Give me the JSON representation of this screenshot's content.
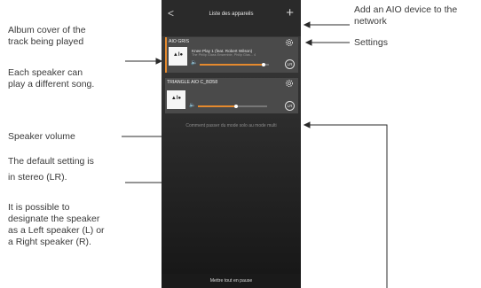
{
  "app": {
    "title": "Liste des appareils",
    "back_glyph": "<",
    "add_glyph": "+",
    "help_text": "Comment passer du mode solo au mode multi",
    "pause_all_label": "Mettre tout en pause"
  },
  "devices": [
    {
      "name": "AIO GRIS",
      "cover_logo": "▲I●",
      "track": "Knee Play 1 (feat. Robert Wilson)",
      "artist_line": "The Philip Glass Ensemble, Philip Glas... 4",
      "volume": 0.92,
      "channel": "LR",
      "active": true,
      "icons": {
        "settings": "gear-icon",
        "volume": "speaker-icon"
      }
    },
    {
      "name": "TRIANGLE AIO C_BD58",
      "cover_logo": "▲I●",
      "track": "",
      "artist_line": "",
      "volume": 0.55,
      "channel": "LR",
      "active": false,
      "icons": {
        "settings": "gear-icon",
        "volume": "speaker-icon"
      }
    }
  ],
  "annotations": {
    "album_cover": [
      "Album cover of the",
      "track being played"
    ],
    "each_speaker": [
      "Each speaker can",
      "play a different song."
    ],
    "speaker_volume": [
      "Speaker volume"
    ],
    "default_setting": [
      "The default setting is",
      "in stereo (LR)."
    ],
    "designate": [
      "It is possible to",
      "designate the speaker",
      "as a Left speaker (L) or",
      "a Right speaker (R)."
    ],
    "add_aio": [
      "Add an AIO device to the",
      "network"
    ],
    "settings": [
      "Settings"
    ]
  },
  "colors": {
    "accent": "#e58a2e",
    "screen_bg": "#2b2b2b",
    "card_bg": "#4a4a4a"
  }
}
